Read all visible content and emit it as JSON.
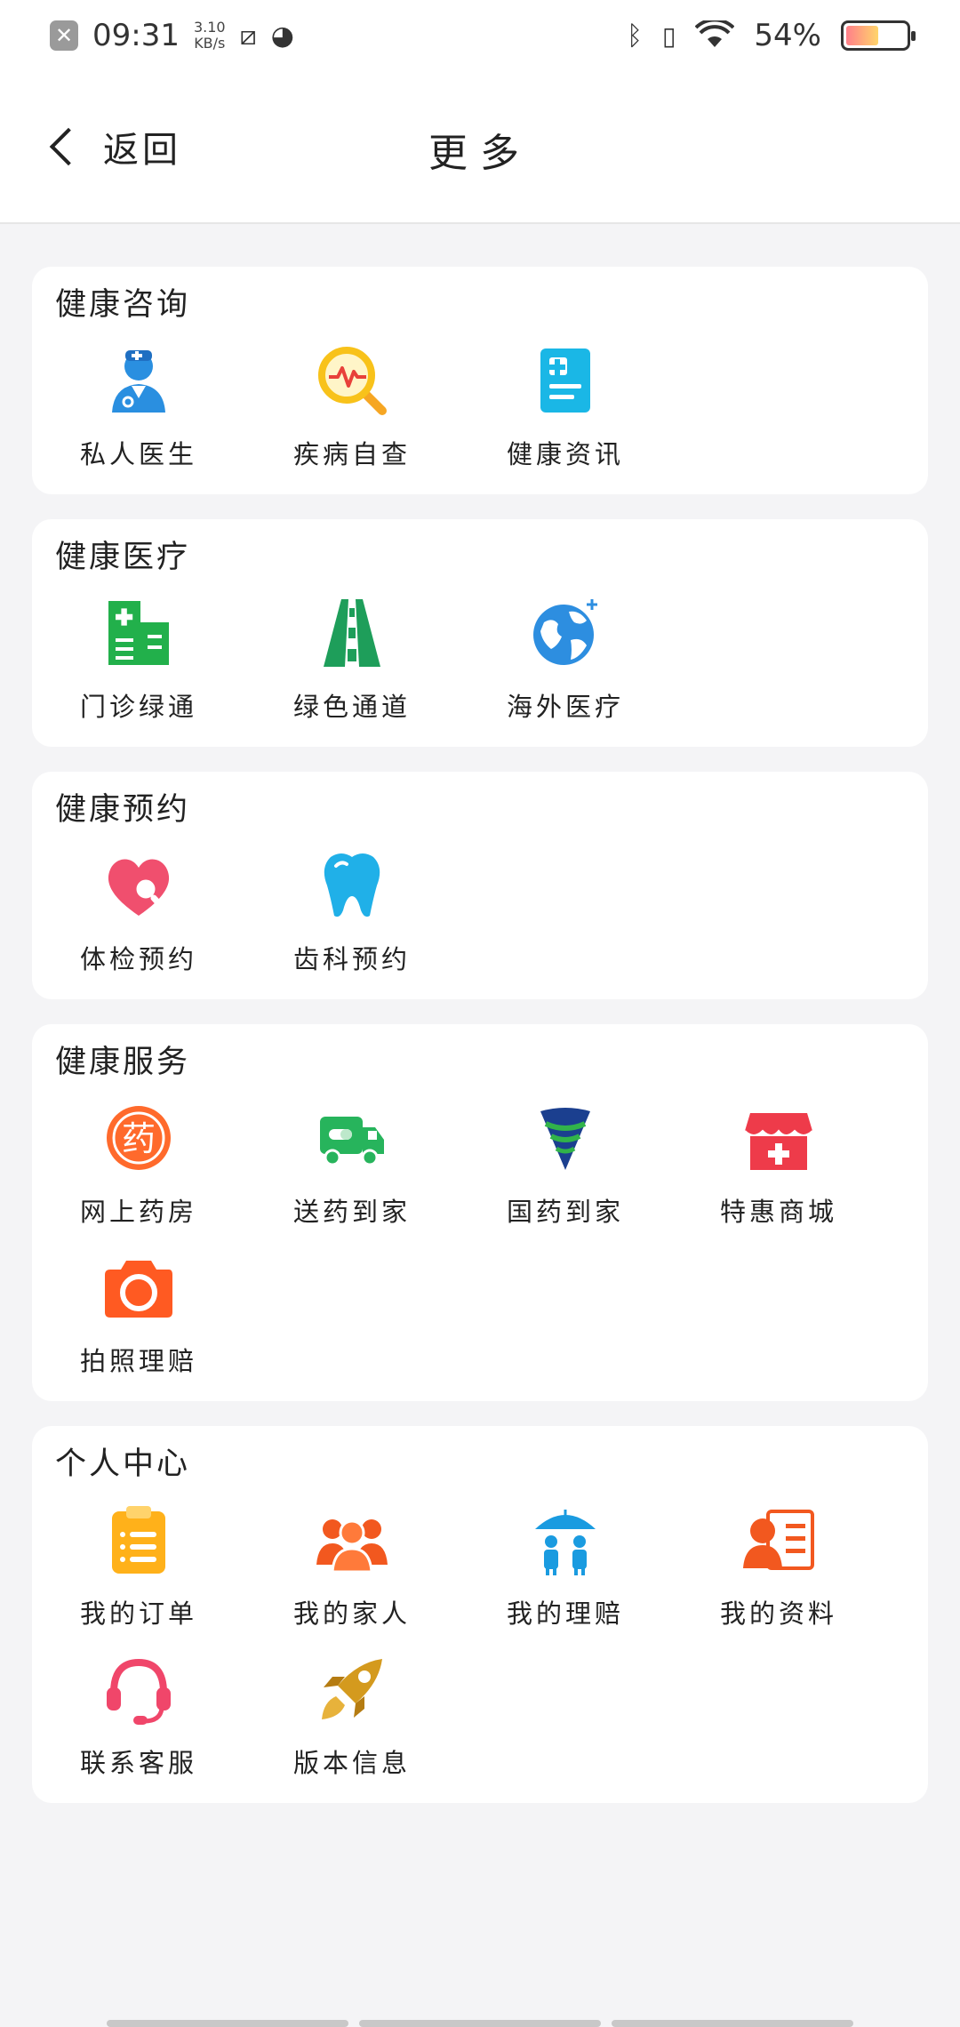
{
  "status_bar": {
    "time": "09:31",
    "speed_value": "3.10",
    "speed_unit": "KB/s",
    "battery": "54%",
    "battery_level": 0.54
  },
  "nav": {
    "back_label": "返回",
    "title": "更多"
  },
  "sections": [
    {
      "title": "健康咨询",
      "items": [
        {
          "label": "私人医生",
          "icon": "doctor-icon"
        },
        {
          "label": "疾病自查",
          "icon": "magnifier-pulse-icon"
        },
        {
          "label": "健康资讯",
          "icon": "medical-document-icon"
        }
      ]
    },
    {
      "title": "健康医疗",
      "items": [
        {
          "label": "门诊绿通",
          "icon": "hospital-building-icon"
        },
        {
          "label": "绿色通道",
          "icon": "road-icon"
        },
        {
          "label": "海外医疗",
          "icon": "globe-icon"
        }
      ]
    },
    {
      "title": "健康预约",
      "items": [
        {
          "label": "体检预约",
          "icon": "heart-search-icon"
        },
        {
          "label": "齿科预约",
          "icon": "tooth-icon"
        }
      ]
    },
    {
      "title": "健康服务",
      "items": [
        {
          "label": "网上药房",
          "icon": "pharmacy-icon",
          "glyph": "药"
        },
        {
          "label": "送药到家",
          "icon": "delivery-truck-icon"
        },
        {
          "label": "国药到家",
          "icon": "sinopharm-logo-icon"
        },
        {
          "label": "特惠商城",
          "icon": "store-icon"
        },
        {
          "label": "拍照理赔",
          "icon": "camera-icon"
        }
      ]
    },
    {
      "title": "个人中心",
      "items": [
        {
          "label": "我的订单",
          "icon": "clipboard-icon"
        },
        {
          "label": "我的家人",
          "icon": "family-icon"
        },
        {
          "label": "我的理赔",
          "icon": "umbrella-family-icon"
        },
        {
          "label": "我的资料",
          "icon": "profile-card-icon"
        },
        {
          "label": "联系客服",
          "icon": "headset-icon"
        },
        {
          "label": "版本信息",
          "icon": "rocket-icon"
        }
      ]
    }
  ]
}
